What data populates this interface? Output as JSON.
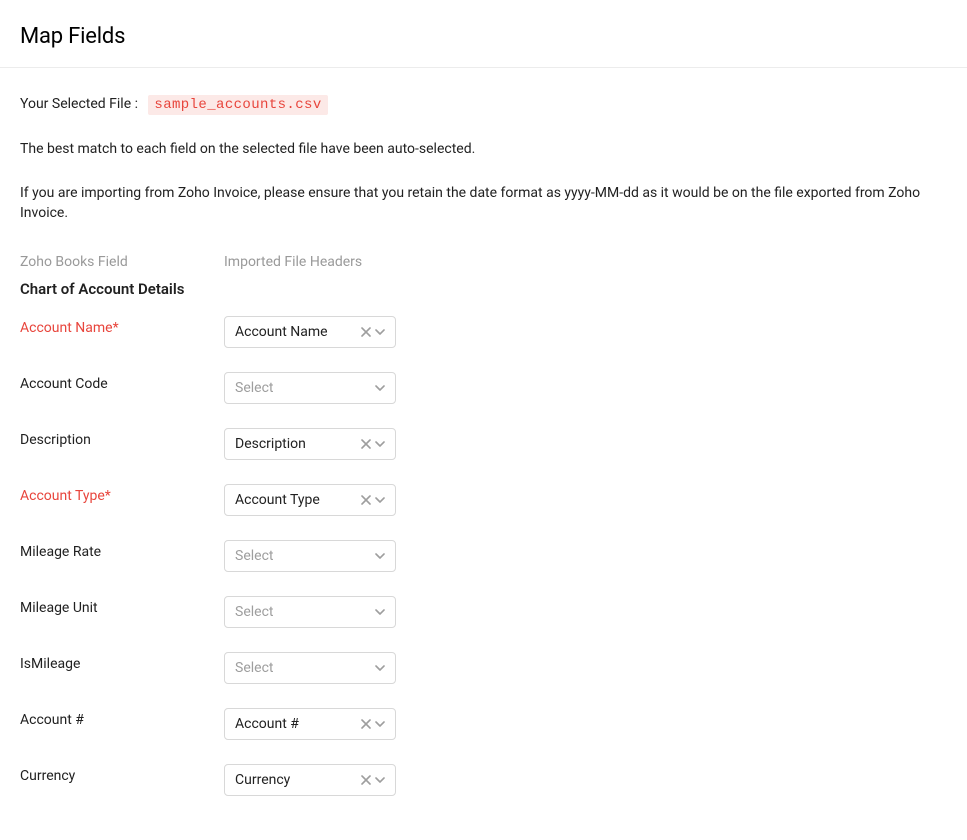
{
  "header": {
    "title": "Map Fields"
  },
  "file": {
    "label": "Your Selected File :",
    "name": "sample_accounts.csv"
  },
  "info1": "The best match to each field on the selected file have been auto-selected.",
  "info2": "If you are importing from Zoho Invoice, please ensure that you retain the date format as yyyy-MM-dd as it would be on the file exported from Zoho Invoice.",
  "columns": {
    "left": "Zoho Books Field",
    "right": "Imported File Headers"
  },
  "section_title": "Chart of Account Details",
  "select_placeholder": "Select",
  "fields": [
    {
      "label": "Account Name*",
      "required": true,
      "value": "Account Name",
      "has_value": true
    },
    {
      "label": "Account Code",
      "required": false,
      "value": "",
      "has_value": false
    },
    {
      "label": "Description",
      "required": false,
      "value": "Description",
      "has_value": true
    },
    {
      "label": "Account Type*",
      "required": true,
      "value": "Account Type",
      "has_value": true
    },
    {
      "label": "Mileage Rate",
      "required": false,
      "value": "",
      "has_value": false
    },
    {
      "label": "Mileage Unit",
      "required": false,
      "value": "",
      "has_value": false
    },
    {
      "label": "IsMileage",
      "required": false,
      "value": "",
      "has_value": false
    },
    {
      "label": "Account #",
      "required": false,
      "value": "Account #",
      "has_value": true
    },
    {
      "label": "Currency",
      "required": false,
      "value": "Currency",
      "has_value": true
    }
  ]
}
